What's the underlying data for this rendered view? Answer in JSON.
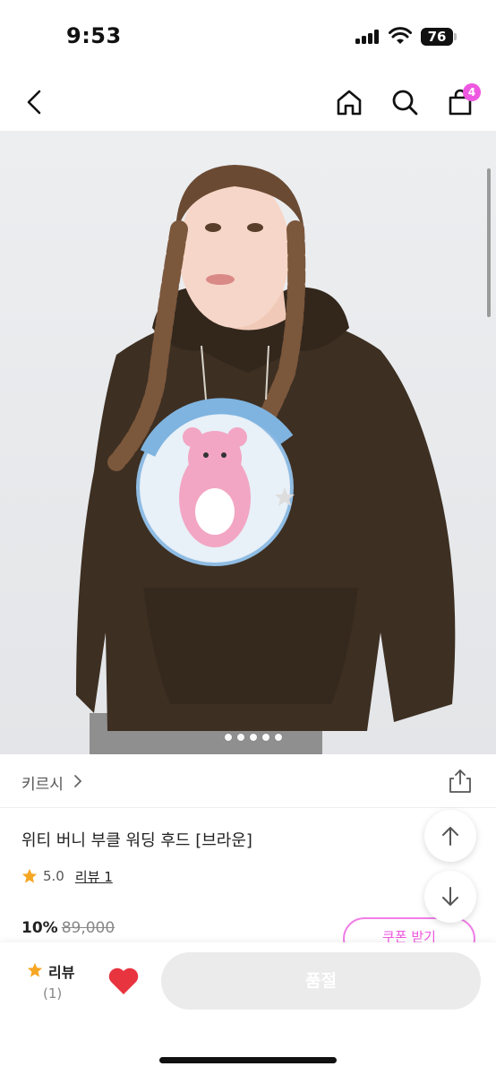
{
  "status_bar": {
    "time": "9:53",
    "battery": "76"
  },
  "nav": {
    "cart_badge": "4"
  },
  "hero": {
    "image_description": "",
    "slides_count": 5,
    "active_slide": 0
  },
  "product": {
    "brand": "키르시",
    "title": "위티 버니 부클 워딩 후드 [브라운]",
    "rating": "5.0",
    "review_link": "리뷰 1",
    "discount": "10%",
    "original_price": "89,000",
    "coupon_label": "쿠폰 받기"
  },
  "bottom_bar": {
    "review_label": "리뷰",
    "review_count": "(1)",
    "soldout_label": "품절"
  },
  "colors": {
    "accent_pink": "#ee58e0",
    "heart_red": "#e8343f",
    "star_orange": "#f5a623",
    "soldout_gray": "#ebebeb"
  }
}
